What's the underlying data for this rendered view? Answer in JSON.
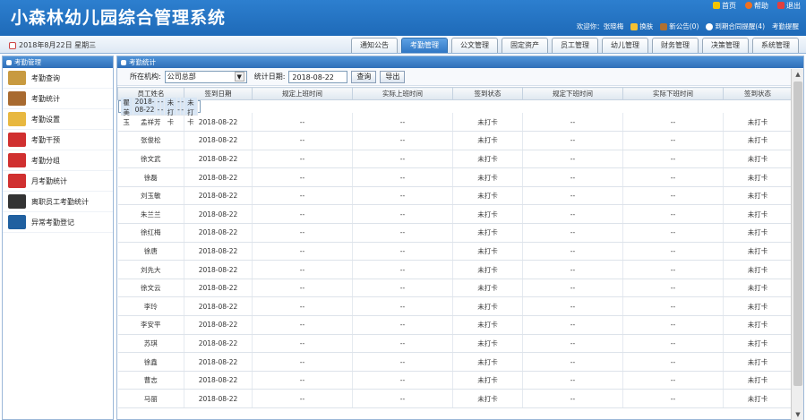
{
  "app": {
    "title": "小森林幼儿园综合管理系统"
  },
  "toplinks": [
    {
      "label": "首页",
      "icon": "home-icon",
      "color": "#f3c400"
    },
    {
      "label": "帮助",
      "icon": "help-icon",
      "color": "#f07020"
    },
    {
      "label": "退出",
      "icon": "exit-icon",
      "color": "#e04040"
    }
  ],
  "userline": {
    "welcome": "欢迎你：张晓梅",
    "switch": "换肤",
    "notice": "新公告(0)",
    "reminder": "到期合同提醒(4)",
    "tip": "考勤提醒"
  },
  "date": "2018年8月22日 星期三",
  "tabs": [
    "通知公告",
    "考勤管理",
    "公文管理",
    "固定资产",
    "员工管理",
    "幼儿管理",
    "财务管理",
    "决策管理",
    "系统管理"
  ],
  "active_tab": 1,
  "sidebar": {
    "title": "考勤管理",
    "items": [
      {
        "label": "考勤查询",
        "icon": "briefcase-icon",
        "color": "#c89a40"
      },
      {
        "label": "考勤统计",
        "icon": "briefcase-icon",
        "color": "#a86a30"
      },
      {
        "label": "考勤设置",
        "icon": "folder-icon",
        "color": "#e8b840"
      },
      {
        "label": "考勤干预",
        "icon": "delete-doc-icon",
        "color": "#d03030"
      },
      {
        "label": "考勤分组",
        "icon": "delete-doc-icon",
        "color": "#d03030"
      },
      {
        "label": "月考勤统计",
        "icon": "delete-doc-icon",
        "color": "#d03030"
      },
      {
        "label": "离职员工考勤统计",
        "icon": "mouse-icon",
        "color": "#333333"
      },
      {
        "label": "异常考勤登记",
        "icon": "user-icon",
        "color": "#2060a0"
      }
    ]
  },
  "main": {
    "title": "考勤统计",
    "org_label": "所在机构:",
    "org_value": "公司总部",
    "date_label": "统计日期:",
    "date_value": "2018-08-22",
    "query": "查询",
    "export": "导出"
  },
  "table": {
    "headers": [
      "员工姓名",
      "签到日期",
      "规定上班时间",
      "实际上班时间",
      "签到状态",
      "规定下班时间",
      "实际下班时间",
      "签到状态"
    ],
    "rows": [
      [
        "瞿美玉",
        "2018-08-22",
        "--",
        "--",
        "未打卡",
        "--",
        "--",
        "未打卡"
      ],
      [
        "孟祥芳",
        "2018-08-22",
        "--",
        "--",
        "未打卡",
        "--",
        "--",
        "未打卡"
      ],
      [
        "张俊松",
        "2018-08-22",
        "--",
        "--",
        "未打卡",
        "--",
        "--",
        "未打卡"
      ],
      [
        "徐文武",
        "2018-08-22",
        "--",
        "--",
        "未打卡",
        "--",
        "--",
        "未打卡"
      ],
      [
        "徐磊",
        "2018-08-22",
        "--",
        "--",
        "未打卡",
        "--",
        "--",
        "未打卡"
      ],
      [
        "刘玉敏",
        "2018-08-22",
        "--",
        "--",
        "未打卡",
        "--",
        "--",
        "未打卡"
      ],
      [
        "朱兰兰",
        "2018-08-22",
        "--",
        "--",
        "未打卡",
        "--",
        "--",
        "未打卡"
      ],
      [
        "徐红梅",
        "2018-08-22",
        "--",
        "--",
        "未打卡",
        "--",
        "--",
        "未打卡"
      ],
      [
        "徐唐",
        "2018-08-22",
        "--",
        "--",
        "未打卡",
        "--",
        "--",
        "未打卡"
      ],
      [
        "刘先大",
        "2018-08-22",
        "--",
        "--",
        "未打卡",
        "--",
        "--",
        "未打卡"
      ],
      [
        "徐文云",
        "2018-08-22",
        "--",
        "--",
        "未打卡",
        "--",
        "--",
        "未打卡"
      ],
      [
        "李玲",
        "2018-08-22",
        "--",
        "--",
        "未打卡",
        "--",
        "--",
        "未打卡"
      ],
      [
        "李安平",
        "2018-08-22",
        "--",
        "--",
        "未打卡",
        "--",
        "--",
        "未打卡"
      ],
      [
        "苏琪",
        "2018-08-22",
        "--",
        "--",
        "未打卡",
        "--",
        "--",
        "未打卡"
      ],
      [
        "徐鑫",
        "2018-08-22",
        "--",
        "--",
        "未打卡",
        "--",
        "--",
        "未打卡"
      ],
      [
        "曹志",
        "2018-08-22",
        "--",
        "--",
        "未打卡",
        "--",
        "--",
        "未打卡"
      ],
      [
        "马丽",
        "2018-08-22",
        "--",
        "--",
        "未打卡",
        "--",
        "--",
        "未打卡"
      ]
    ]
  }
}
